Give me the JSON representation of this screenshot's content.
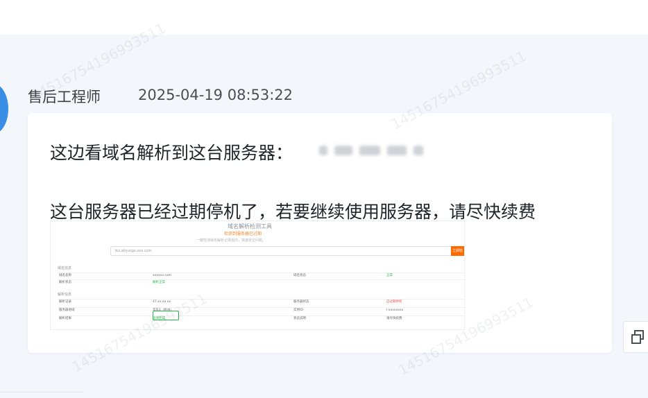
{
  "message": {
    "sender": "售后工程师",
    "timestamp": "2025-04-19 08:53:22",
    "line1": "这边看域名解析到这台服务器：",
    "line2": "这台服务器已经过期停机了，若要继续使用服务器，请尽快续费"
  },
  "embedded_screenshot": {
    "title": "域名解析检测工具",
    "notice": "检测到服务器已过期",
    "subnote": "一键检测域名解析记录指向，快速定位问题。",
    "search_value": "biz.aliyungs.xxx.com",
    "search_button": "立即检测",
    "section1": "域名信息",
    "section2": "解析信息",
    "rows": [
      {
        "a": "域名名称",
        "b": "xxxxxx.com",
        "c": "域名状态",
        "d": "正常"
      },
      {
        "a": "解析状态",
        "b": "解析正常",
        "c": "",
        "d": ""
      },
      {
        "a": "解析记录",
        "b": "47.xx.xx.xx",
        "c": "服务器状态",
        "d": "已过期停机"
      },
      {
        "a": "服务器地域",
        "b": "华东1（杭州）",
        "c": "实例ID",
        "d": "i-xxxxxxxx"
      },
      {
        "a": "解析结果",
        "b": "检测完成",
        "c": "状态说明",
        "d": "请尽快续费"
      }
    ]
  },
  "watermark_text": "14516754196993511",
  "icons": {
    "copy": "copy-icon"
  }
}
